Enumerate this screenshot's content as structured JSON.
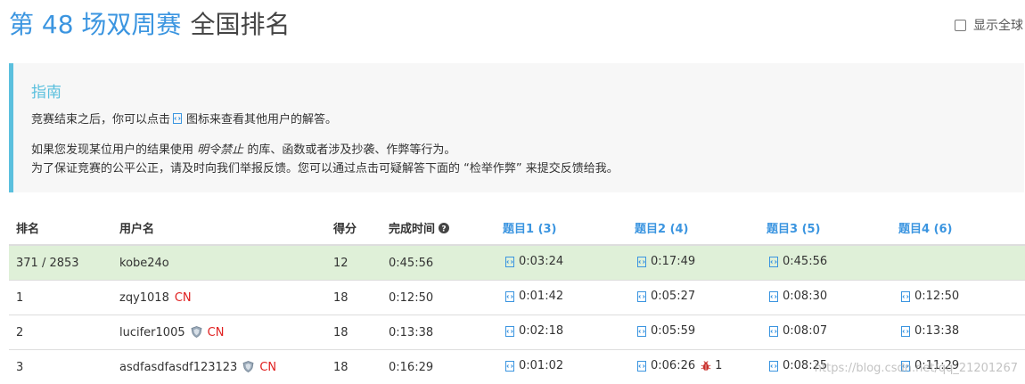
{
  "header": {
    "contest_title": "第 48 场双周赛",
    "rank_title": "全国排名",
    "global_toggle_label": "显示全球"
  },
  "guide": {
    "title": "指南",
    "line1_pre": "竞赛结束之后，你可以点击",
    "line1_post": "图标来查看其他用户的解答。",
    "line2_pre": "如果您发现某位用户的结果使用",
    "line2_em": "明令禁止",
    "line2_post": "的库、函数或者涉及抄袭、作弊等行为。",
    "line3": "为了保证竞赛的公平公正，请及时向我们举报反馈。您可以通过点击可疑解答下面的 “检举作弊” 来提交反馈给我。"
  },
  "table": {
    "headers": {
      "rank": "排名",
      "user": "用户名",
      "score": "得分",
      "finish_time": "完成时间",
      "q1": "题目1 (3)",
      "q2": "题目2 (4)",
      "q3": "题目3 (5)",
      "q4": "题目4 (6)"
    },
    "my_row": {
      "rank": "371 / 2853",
      "user": "kobe24o",
      "score": "12",
      "finish_time": "0:45:56",
      "q1": "0:03:24",
      "q2": "0:17:49",
      "q3": "0:45:56",
      "q4": ""
    },
    "rows": [
      {
        "rank": "1",
        "user": "zqy1018",
        "region": "CN",
        "score": "18",
        "finish_time": "0:12:50",
        "q1": "0:01:42",
        "q2": "0:05:27",
        "q3": "0:08:30",
        "q4": "0:12:50"
      },
      {
        "rank": "2",
        "user": "lucifer1005",
        "region": "CN",
        "score": "18",
        "finish_time": "0:13:38",
        "q1": "0:02:18",
        "q2": "0:05:59",
        "q3": "0:08:07",
        "q4": "0:13:38"
      },
      {
        "rank": "3",
        "user": "asdfasdfasdf123123",
        "region": "CN",
        "score": "18",
        "finish_time": "0:16:29",
        "q1": "0:01:02",
        "q2": "0:06:26",
        "q2_bugs": "1",
        "q3": "0:08:25",
        "q4": "0:11:29"
      }
    ]
  },
  "watermark": "https://blog.csdn.net/qq_21201267",
  "colors": {
    "accent": "#3b95e0",
    "guide_border": "#5bc0de",
    "my_row_bg": "#dff0d8",
    "region": "#e02020"
  },
  "icons": {
    "solution": "doc-code-icon",
    "badge": "shield-icon",
    "wrong_answer": "bug-icon",
    "help": "question-circle-icon"
  }
}
